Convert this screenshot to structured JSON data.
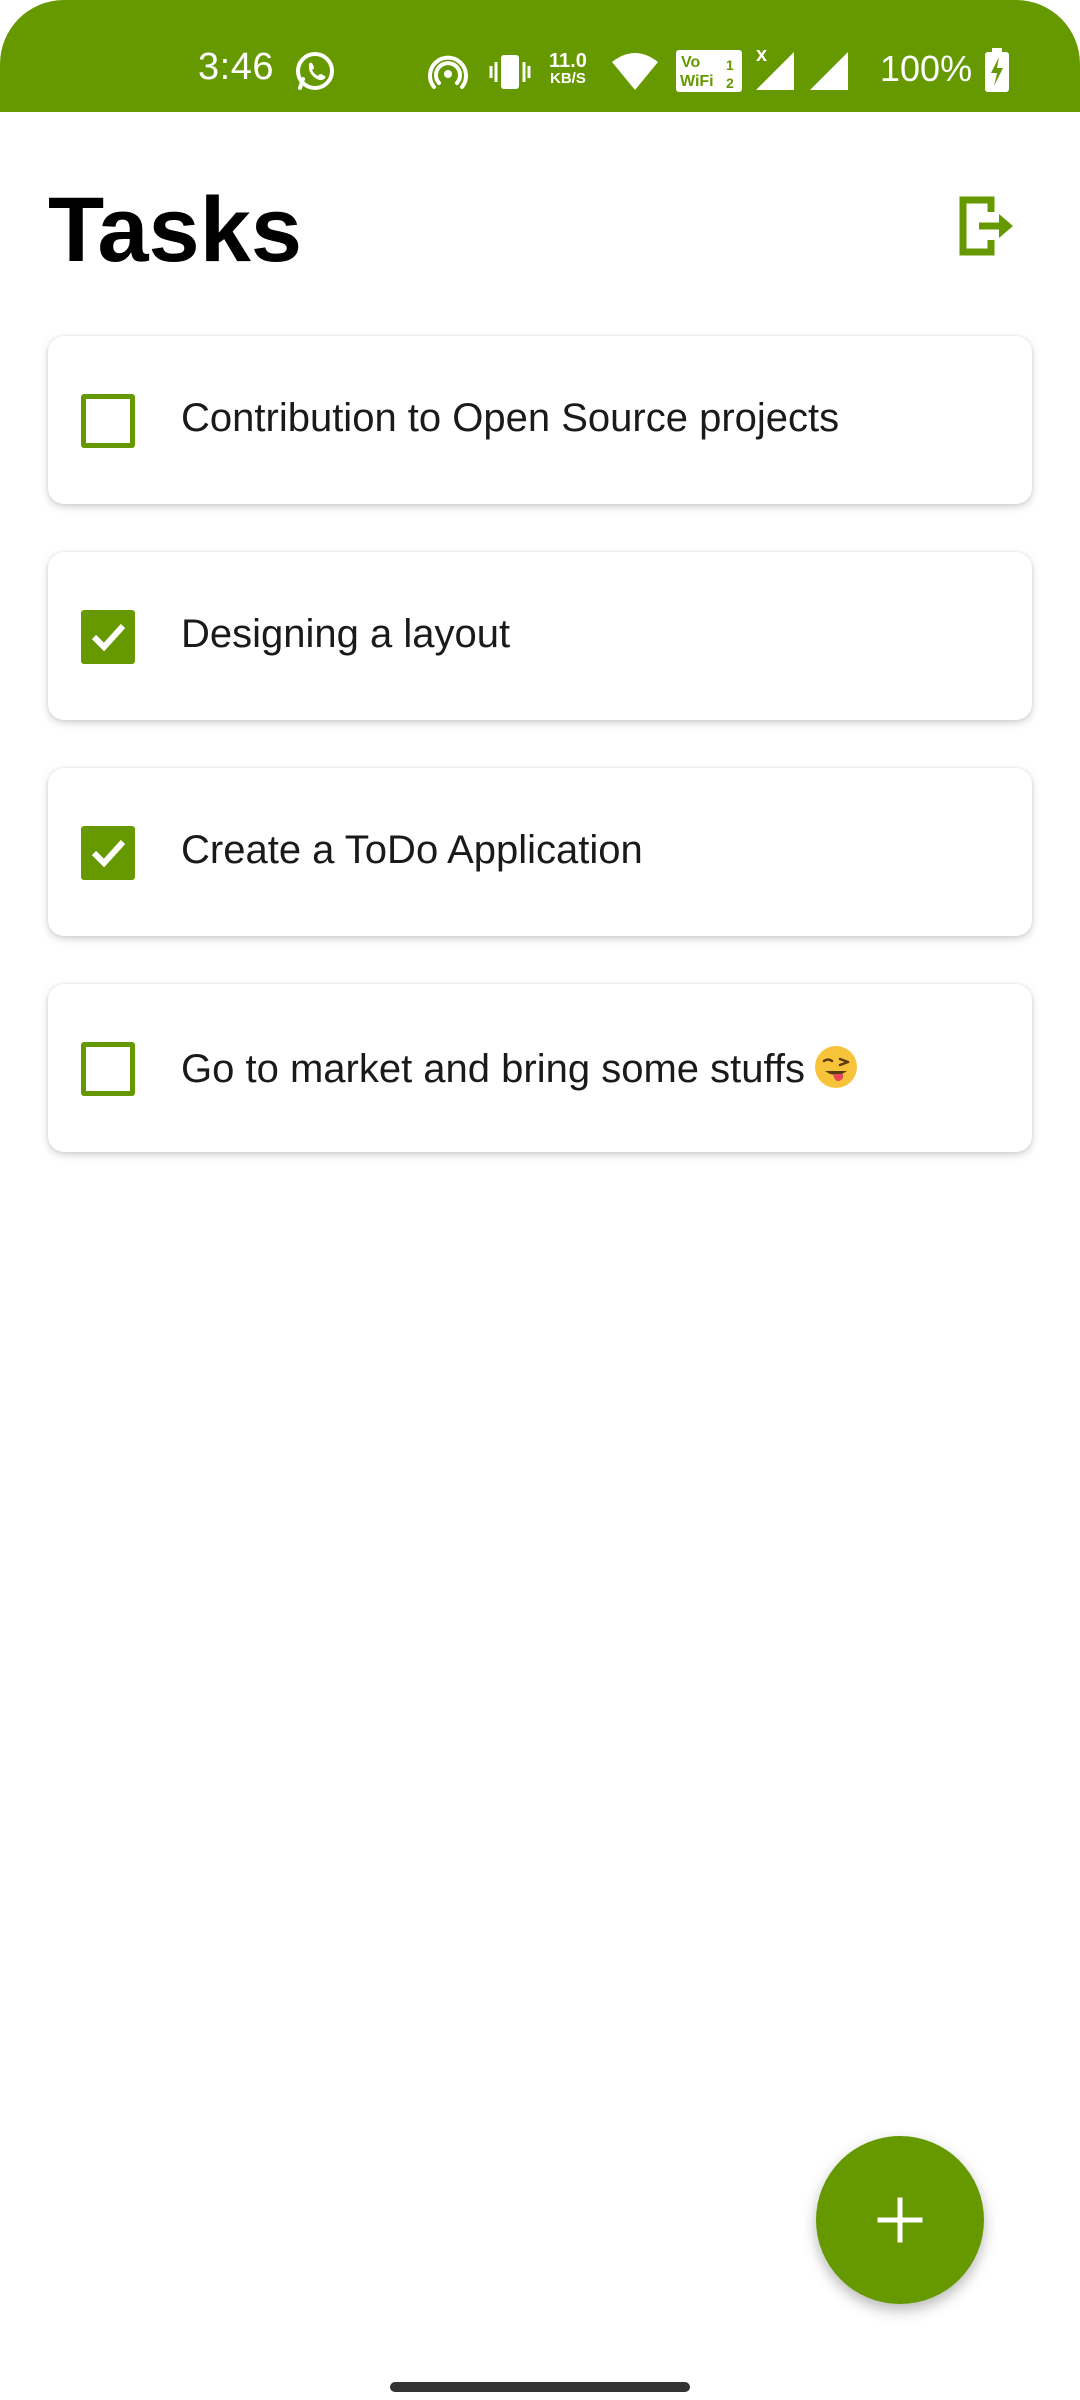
{
  "status_bar": {
    "time": "3:46",
    "network_speed_value": "11.0",
    "network_speed_unit": "KB/S",
    "vowifi_label": "Vo\nWiFi 2",
    "battery_percent": "100%",
    "icons": [
      "whatsapp-icon",
      "hotspot-icon",
      "vibrate-icon",
      "wifi-icon",
      "signal-icon",
      "battery-charging-icon"
    ]
  },
  "header": {
    "title": "Tasks",
    "logout_icon": "logout-icon"
  },
  "tasks": [
    {
      "label": "Contribution to Open Source projects",
      "checked": false
    },
    {
      "label": "Designing a layout",
      "checked": true
    },
    {
      "label": "Create a ToDo Application",
      "checked": true
    },
    {
      "label": "Go to market and bring some stuffs",
      "checked": false,
      "emoji": "winking-face-with-tongue"
    }
  ],
  "fab": {
    "icon": "plus-icon"
  },
  "colors": {
    "accent": "#669900",
    "background": "#ffffff",
    "text": "#1a1a1a"
  }
}
